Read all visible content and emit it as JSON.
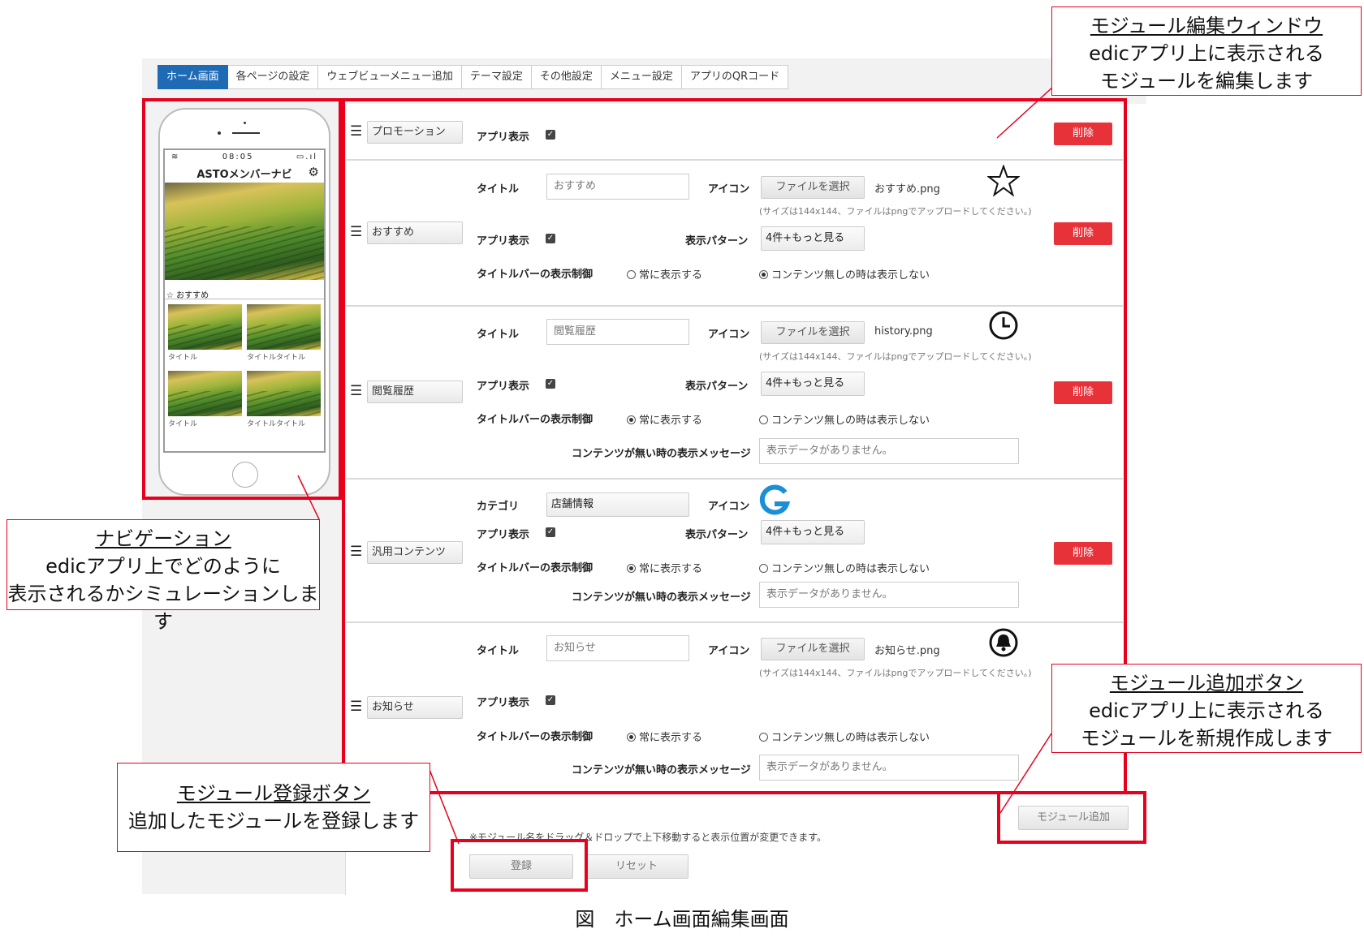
{
  "tabs": [
    "ホーム画面",
    "各ページの設定",
    "ウェブビューメニュー追加",
    "テーマ設定",
    "その他設定",
    "メニュー設定",
    "アプリのQRコード"
  ],
  "phone": {
    "time": "08:05",
    "app_title": "ASTOメンバーナビ",
    "section_label": "おすすめ",
    "cards": [
      "タイトル",
      "タイトルタイトル",
      "タイトル",
      "タイトルタイトル"
    ]
  },
  "labels": {
    "app_display": "アプリ表示",
    "title": "タイトル",
    "icon": "アイコン",
    "display_pattern": "表示パターン",
    "titlebar_control": "タイトルバーの表示制御",
    "always_show": "常に表示する",
    "hide_when_empty": "コンテンツ無しの時は表示しない",
    "empty_message": "コンテンツが無い時の表示メッセージ",
    "category": "カテゴリ",
    "choose_file": "ファイルを選択",
    "size_note": "(サイズは144x144、ファイルはpngでアップロードしてください。)",
    "delete": "削除"
  },
  "modules": [
    {
      "name": "プロモーション",
      "app_display": true
    },
    {
      "name": "おすすめ",
      "title_value": "おすすめ",
      "file": "おすすめ.png",
      "pattern": "4件+もっと見る",
      "titlebar": "hide_when_empty",
      "icon": "star-icon"
    },
    {
      "name": "閲覧履歴",
      "title_value": "閲覧履歴",
      "file": "history.png",
      "pattern": "4件+もっと見る",
      "titlebar": "always_show",
      "empty_message": "表示データがありません。",
      "icon": "clock-icon"
    },
    {
      "name": "汎用コンテンツ",
      "category": "店舗情報",
      "pattern": "4件+もっと見る",
      "titlebar": "always_show",
      "empty_message": "表示データがありません。",
      "icon": "g-logo-icon"
    },
    {
      "name": "お知らせ",
      "title_value": "お知らせ",
      "file": "お知らせ.png",
      "titlebar": "always_show",
      "empty_message": "表示データがありません。",
      "icon": "bell-icon"
    }
  ],
  "footer": {
    "add_module": "モジュール追加",
    "drag_note": "※モジュール名をドラッグ＆ドロップで上下移動すると表示位置が変更できます。",
    "register": "登録",
    "reset": "リセット"
  },
  "callouts": {
    "edit_window": {
      "title": "モジュール編集ウィンドウ",
      "line1": "edicアプリ上に表示される",
      "line2": "モジュールを編集します"
    },
    "navigation": {
      "title": "ナビゲーション",
      "line1": "edicアプリ上でどのように",
      "line2": "表示されるかシミュレーションします"
    },
    "register": {
      "title": "モジュール登録ボタン",
      "line1": "追加したモジュールを登録します"
    },
    "add": {
      "title": "モジュール追加ボタン",
      "line1": "edicアプリ上に表示される",
      "line2": "モジュールを新規作成します"
    }
  },
  "caption": "図　ホーム画面編集画面",
  "colors": {
    "accent": "#1f6ab5",
    "delete": "#e8323a",
    "highlight": "#e8001c"
  }
}
